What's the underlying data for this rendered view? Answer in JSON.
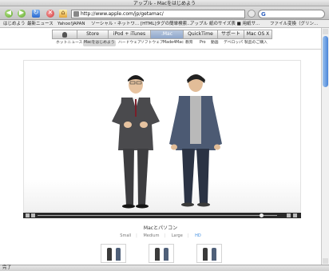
{
  "window": {
    "title": "アップル - Macをはじめよう"
  },
  "toolbar": {
    "url": "http://www.apple.com/jp/getamac/",
    "search_logo": "G"
  },
  "bookmarks": [
    "はじめよう",
    "最新ニュース",
    "Yahoo!JAPAN",
    "ソーシャル・ネットワ...",
    "[HTML]タグの簡単検索...",
    "アップル",
    "紙のサイズ表 ■ 用紙サ...",
    "ファイル変換（グリン..."
  ],
  "nav": {
    "tabs": [
      "",
      "Store",
      "iPod + iTunes",
      ".Mac",
      "QuickTime",
      "サポート",
      "Mac OS X"
    ],
    "subnav": [
      "ホットニュース",
      "Macをはじめよう",
      "ハードウェア",
      "ソフトウェア",
      "Made4Mac",
      "教育",
      "Pro",
      "動画",
      "デベロッパ",
      "製品のご購入"
    ]
  },
  "video": {
    "caption": "Macとパソコン",
    "sizes": [
      "Small",
      "Medium",
      "Large",
      "HD"
    ],
    "active_size": "HD"
  },
  "status": {
    "text": "完了"
  },
  "colors": {
    "accent": "#3f8de0",
    "nav_active": "#8ea6cb"
  }
}
